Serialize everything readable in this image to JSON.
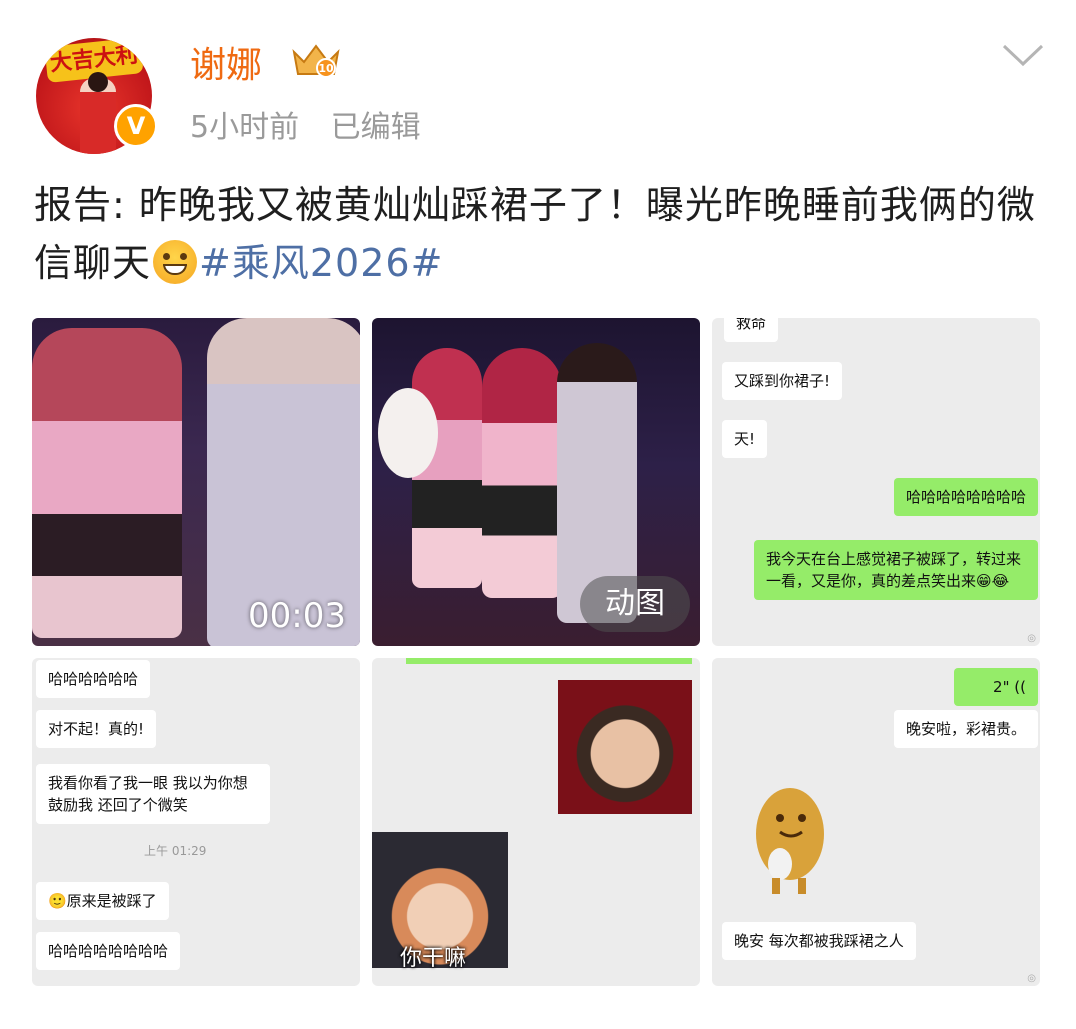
{
  "header": {
    "avatar_banner": "大吉大利",
    "username": "谢娜",
    "time": "5小时前",
    "edited": "已编辑"
  },
  "post": {
    "text": "报告: 昨晚我又被黄灿灿踩裙子了！曝光昨晚睡前我俩的微信聊天",
    "hashtag": "#乘风2026#"
  },
  "media": [
    {
      "type": "video",
      "duration": "00:03"
    },
    {
      "type": "gif",
      "label": "动图"
    }
  ],
  "chat3": {
    "top_partial": "救命",
    "msgs_left": [
      "又踩到你裙子!",
      "天!"
    ],
    "msgs_right": [
      "哈哈哈哈哈哈哈哈",
      "我今天在台上感觉裙子被踩了，转过来一看，又是你，真的差点笑出来😁😂"
    ]
  },
  "chat4": {
    "msgs": [
      "哈哈哈哈哈哈",
      "对不起！真的!",
      "我看你看了我一眼 我以为你想鼓励我 还回了个微笑"
    ],
    "timestamp": "上午 01:29",
    "msgs2": [
      "🙂原来是被踩了",
      "哈哈哈哈哈哈哈哈"
    ]
  },
  "chat5": {
    "meme_caption": "你干嘛"
  },
  "chat6": {
    "voice": "2\"",
    "msgs": [
      "晚安啦，彩裙贵。",
      "晚安 每次都被我踩裙之人"
    ]
  },
  "colors": {
    "username": "#ef6a12",
    "hashtag": "#4e6fa5",
    "wechat_green": "#95ec69",
    "vip_orange": "#ffa200"
  }
}
